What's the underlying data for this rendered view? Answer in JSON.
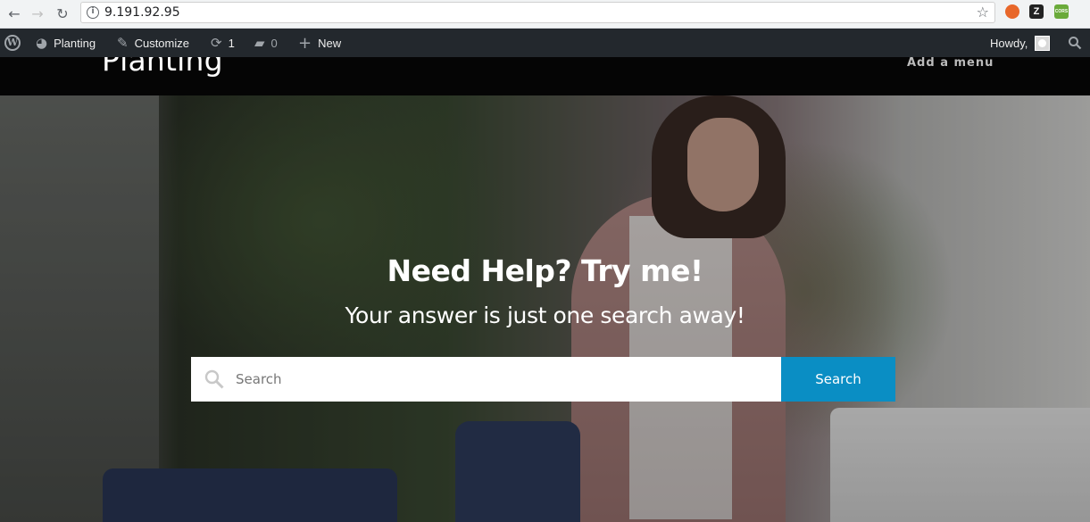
{
  "browser": {
    "back_icon": "←",
    "forward_icon": "→",
    "reload_icon": "↻",
    "url": "9.191.92.95",
    "star_icon": "☆",
    "extensions": [
      {
        "name": "ublock-extension-icon",
        "label": "",
        "color": "#e8672a"
      },
      {
        "name": "zotero-extension-icon",
        "label": "Z",
        "color": "#222222"
      },
      {
        "name": "cors-extension-icon",
        "label": "CORS",
        "color": "#6aaa3a"
      }
    ]
  },
  "admin_bar": {
    "site_name": "Planting",
    "customize": "Customize",
    "updates_count": "1",
    "comments_count": "0",
    "new_label": "New",
    "howdy": "Howdy,"
  },
  "site": {
    "title": "Planting",
    "menu_placeholder": "Add a menu"
  },
  "hero": {
    "title": "Need Help? Try me!",
    "subtitle": "Your answer is just one search away!",
    "search_placeholder": "Search",
    "search_button": "Search"
  },
  "colors": {
    "admin_bar": "#23282d",
    "header": "#050505",
    "search_button": "#0a8ec4"
  }
}
